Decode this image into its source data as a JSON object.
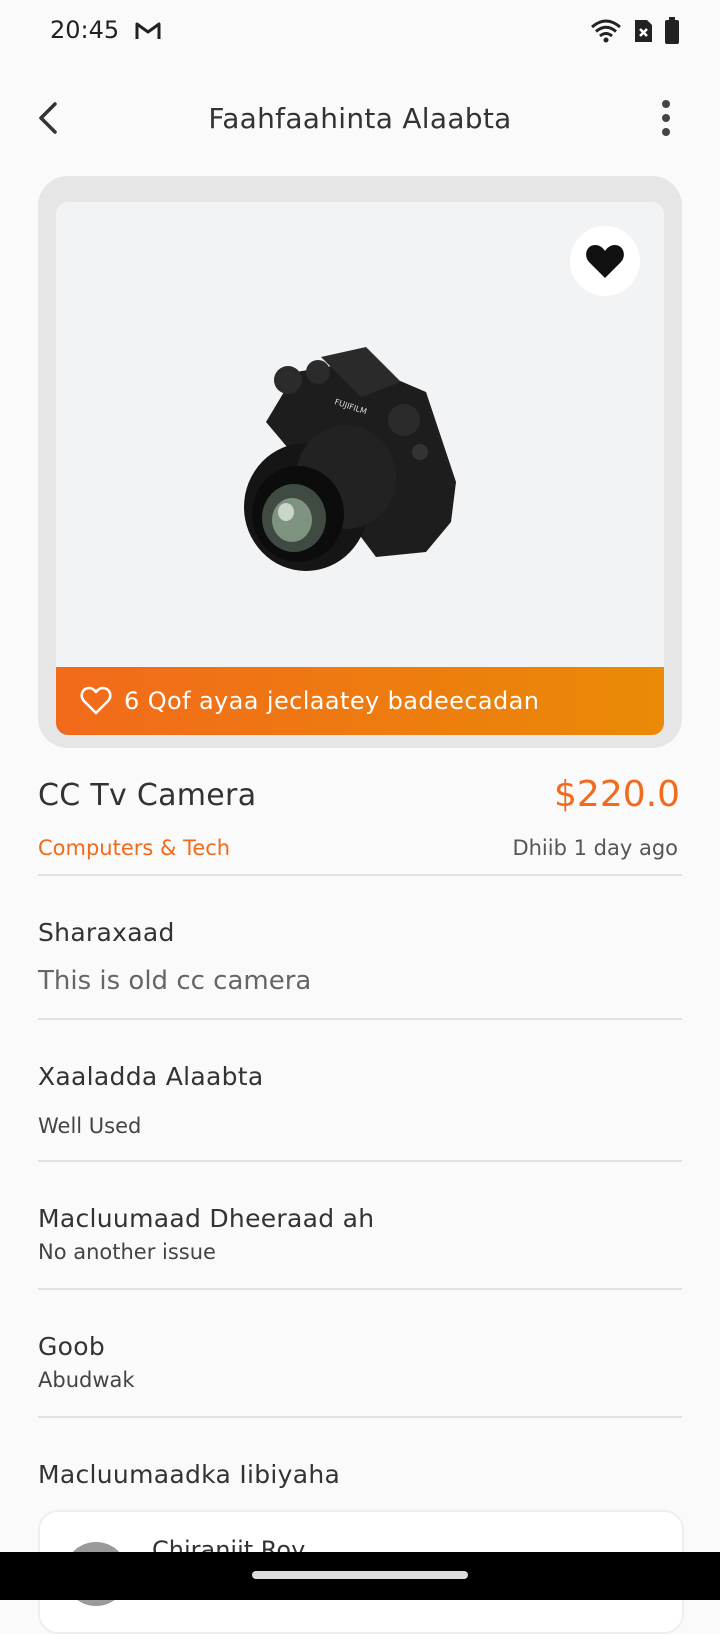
{
  "status": {
    "time": "20:45"
  },
  "header": {
    "title": "Faahfaahinta Alaabta"
  },
  "image": {
    "likes_text": "6 Qof ayaa jeclaatey badeecadan"
  },
  "product": {
    "name": "CC Tv Camera",
    "price": "$220.0",
    "category": "Computers & Tech",
    "posted": "Dhiib 1 day ago"
  },
  "description": {
    "label": "Sharaxaad",
    "value": "This is old cc camera"
  },
  "condition": {
    "label": "Xaaladda Alaabta",
    "value": "Well Used"
  },
  "extra": {
    "label": "Macluumaad Dheeraad ah",
    "value": "No another issue"
  },
  "location": {
    "label": "Goob",
    "value": "Abudwak"
  },
  "seller": {
    "section_label": "Macluumaadka Iibiyaha",
    "name": "Chiranjit Roy"
  },
  "colors": {
    "accent": "#f26a1b"
  }
}
